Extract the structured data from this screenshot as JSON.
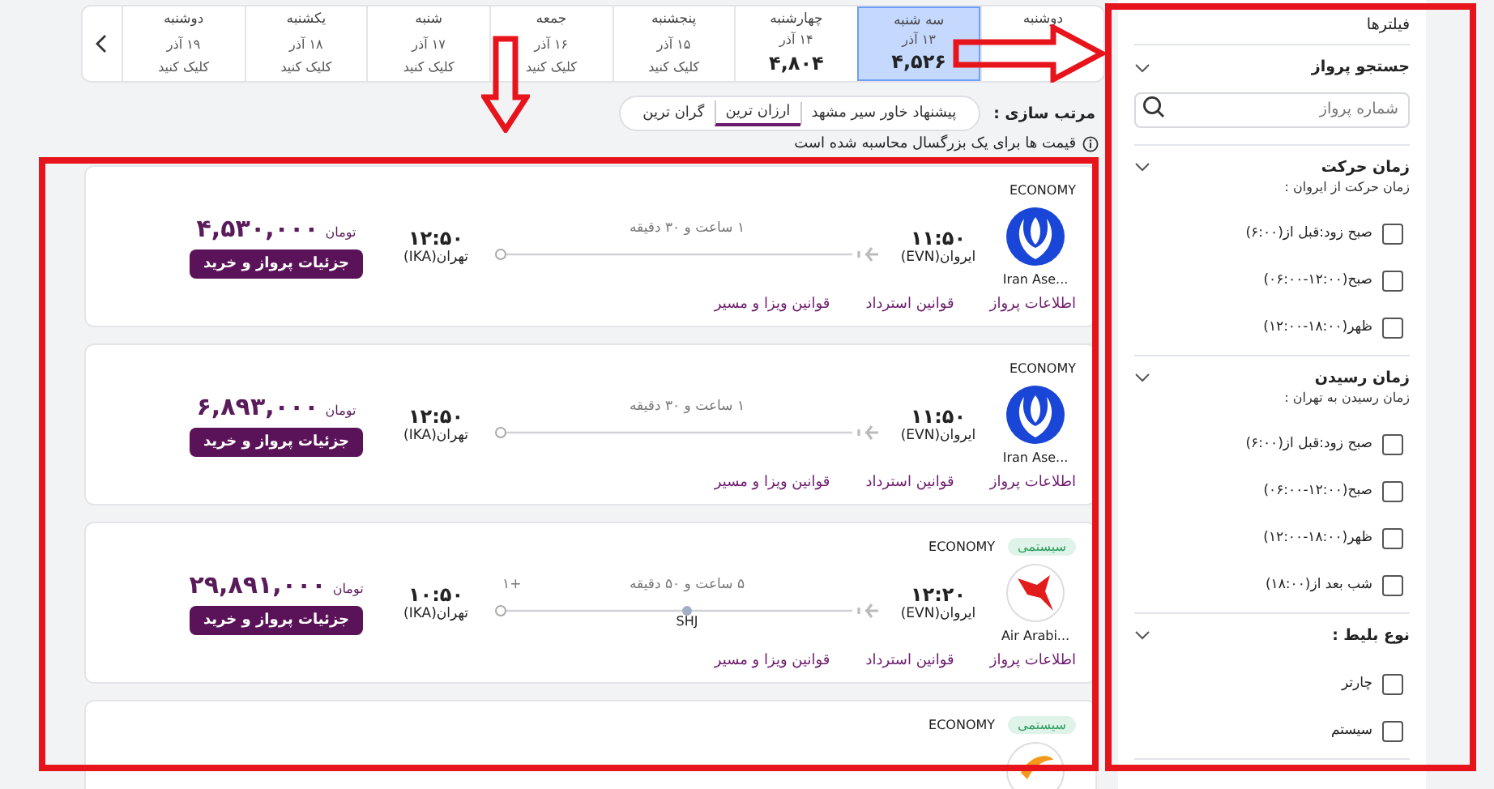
{
  "date_strip": {
    "days": [
      {
        "day": "دوشنبه",
        "selected": false
      },
      {
        "day": "سه شنبه",
        "date": "۱۳ آذر",
        "price": "۴,۵۲۶",
        "selected": true
      },
      {
        "day": "چهارشنبه",
        "date": "۱۴ آذر",
        "price": "۴,۸۰۴",
        "selected": false
      },
      {
        "day": "پنجشنبه",
        "date": "۱۵ آذر",
        "action": "کلیک کنید",
        "selected": false
      },
      {
        "day": "جمعه",
        "date": "۱۶ آذر",
        "action": "کلیک کنید",
        "selected": false
      },
      {
        "day": "شنبه",
        "date": "۱۷ آذر",
        "action": "کلیک کنید",
        "selected": false
      },
      {
        "day": "یکشنبه",
        "date": "۱۸ آذر",
        "action": "کلیک کنید",
        "selected": false
      },
      {
        "day": "دوشنبه",
        "date": "۱۹ آذر",
        "action": "کلیک کنید",
        "selected": false
      }
    ]
  },
  "sort": {
    "label": "مرتب سازی :",
    "options": [
      {
        "label": "پیشنهاد خاور سیر مشهد",
        "selected": false
      },
      {
        "label": "ارزان ترین",
        "selected": true
      },
      {
        "label": "گران ترین",
        "selected": false
      }
    ]
  },
  "price_note": "قیمت ها برای یک بزرگسال محاسبه شده است",
  "flights": [
    {
      "cabin": "ECONOMY",
      "kind": "blue-bird",
      "airline": "Iran Ase...",
      "depart_time": "۱۱:۵۰",
      "depart_airport": "ایروان(EVN)",
      "duration": "۱ ساعت و ۳۰ دقیقه",
      "arrive_time": "۱۲:۵۰",
      "arrive_airport": "تهران(IKA)",
      "price": "۴,۵۳۰,۰۰۰",
      "currency": "تومان",
      "button": "جزئیات پرواز و خرید",
      "links": [
        "اطلاعات پرواز",
        "قوانین استرداد",
        "قوانین ویزا و مسیر"
      ]
    },
    {
      "cabin": "ECONOMY",
      "kind": "blue-bird",
      "airline": "Iran Ase...",
      "depart_time": "۱۱:۵۰",
      "depart_airport": "ایروان(EVN)",
      "duration": "۱ ساعت و ۳۰ دقیقه",
      "arrive_time": "۱۲:۵۰",
      "arrive_airport": "تهران(IKA)",
      "price": "۶,۸۹۳,۰۰۰",
      "currency": "تومان",
      "button": "جزئیات پرواز و خرید",
      "links": [
        "اطلاعات پرواز",
        "قوانین استرداد",
        "قوانین ویزا و مسیر"
      ]
    },
    {
      "badge": "سیستمی",
      "cabin": "ECONOMY",
      "kind": "red-bird",
      "airline": "Air Arabi...",
      "depart_time": "۱۲:۲۰",
      "depart_airport": "ایروان(EVN)",
      "duration": "۵ ساعت و ۵۰ دقیقه",
      "stop": "SHJ",
      "next_day": "+۱",
      "arrive_time": "۱۰:۵۰",
      "arrive_airport": "تهران(IKA)",
      "price": "۲۹,۸۹۱,۰۰۰",
      "currency": "تومان",
      "button": "جزئیات پرواز و خرید",
      "links": [
        "اطلاعات پرواز",
        "قوانین استرداد",
        "قوانین ویزا و مسیر"
      ]
    },
    {
      "badge": "سیستمی",
      "cabin": "ECONOMY",
      "kind": "orange"
    }
  ],
  "filters": {
    "title": "فیلترها",
    "sections": [
      {
        "kind": "search",
        "title": "جستجو پرواز",
        "placeholder": "شماره پرواز"
      },
      {
        "kind": "checklist",
        "title": "زمان حرکت",
        "subtitle": "زمان حرکت از ایروان :",
        "options": [
          {
            "label": "صبح زود:قبل از(۶:۰۰)",
            "checked": false
          },
          {
            "label": "صبح(۱۲:۰۰-۰۶:۰۰)",
            "checked": false
          },
          {
            "label": "ظهر(۱۸:۰۰-۱۲:۰۰)",
            "checked": false
          }
        ]
      },
      {
        "kind": "checklist",
        "title": "زمان رسیدن",
        "subtitle": "زمان رسیدن به تهران :",
        "options": [
          {
            "label": "صبح زود:قبل از(۶:۰۰)",
            "checked": false
          },
          {
            "label": "صبح(۱۲:۰۰-۰۶:۰۰)",
            "checked": false
          },
          {
            "label": "ظهر(۱۸:۰۰-۱۲:۰۰)",
            "checked": false
          },
          {
            "label": "شب بعد از(۱۸:۰۰)",
            "checked": false
          }
        ]
      },
      {
        "kind": "checklist",
        "title": "نوع بلیط :",
        "options": [
          {
            "label": "چارتر",
            "checked": false
          },
          {
            "label": "سیستم",
            "checked": false
          }
        ]
      }
    ]
  },
  "annotations": [
    {
      "kind": "frame"
    },
    {
      "kind": "frame"
    },
    {
      "kind": "arrow_down"
    },
    {
      "kind": "arrow_right"
    }
  ]
}
